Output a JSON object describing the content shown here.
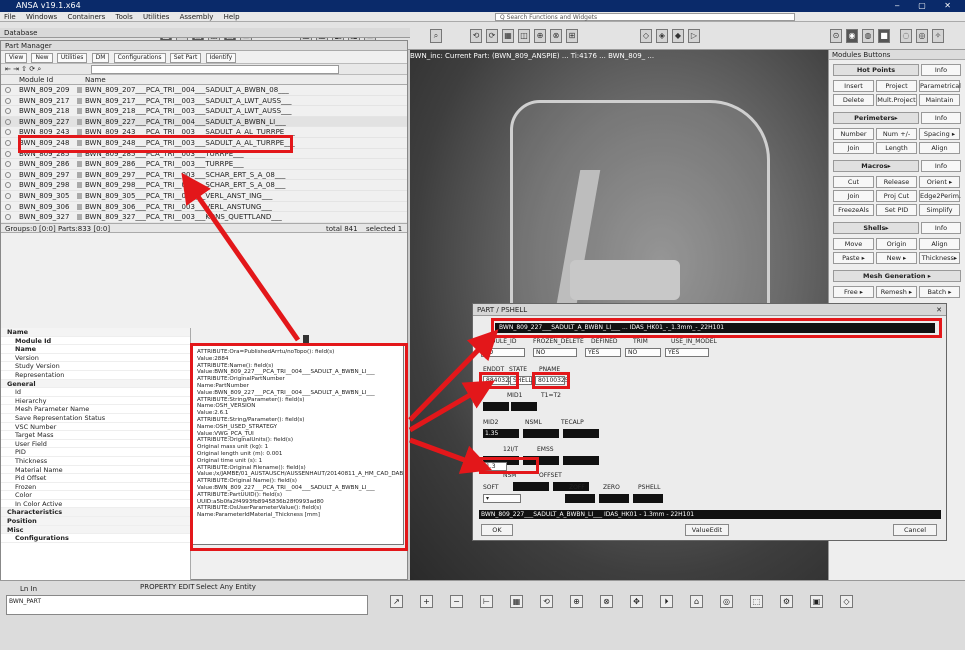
{
  "window": {
    "title": "ANSA v19.1.x64",
    "controls": "‒ ▢ ✕"
  },
  "menu": {
    "items": [
      "File",
      "Windows",
      "Containers",
      "Tools",
      "Utilities",
      "Assembly",
      "Help"
    ],
    "search_placeholder": "Q Search Functions and Widgets"
  },
  "database_label": "Database",
  "part_manager": {
    "title": "Part Manager",
    "tabs": [
      "View",
      "New",
      "Utilities",
      "DM",
      "Configurations",
      "Set Part",
      "Identify"
    ],
    "columns": [
      "Module Id",
      "Name"
    ],
    "rows": [
      {
        "id": "BWN_809_209",
        "name": "BWN_809_207___PCA_TRI__004___SADULT_A_BWBN_08___"
      },
      {
        "id": "BWN_809_217",
        "name": "BWN_809_217___PCA_TRI__003___SADULT_A_LWT_AUSS___"
      },
      {
        "id": "BWN_809_218",
        "name": "BWN_809_218___PCA_TRI__003___SADULT_A_LWT_AUSS___"
      },
      {
        "id": "BWN_809_227",
        "name": "BWN_809_227___PCA_TRI__004___SADULT_A_BWBN_LI___"
      },
      {
        "id": "BWN_809_243",
        "name": "BWN_809_243___PCA_TRI__003___SADULT_A_AL_TURRPE___"
      },
      {
        "id": "BWN_809_248",
        "name": "BWN_809_248___PCA_TRI__003___SADULT_A_AL_TURRPE___"
      },
      {
        "id": "BWN_809_285",
        "name": "BWN_809_285___PCA_TRI__003___TURRPE___"
      },
      {
        "id": "BWN_809_286",
        "name": "BWN_809_286___PCA_TRI__003___TURRPE___"
      },
      {
        "id": "BWN_809_297",
        "name": "BWN_809_297___PCA_TRI__003___SCHAR_ERT_S_A_08___"
      },
      {
        "id": "BWN_809_298",
        "name": "BWN_809_298___PCA_TRI__003___SCHAR_ERT_S_A_08___"
      },
      {
        "id": "BWN_809_305",
        "name": "BWN_809_305___PCA_TRI__003___VERL_ANST_ING___"
      },
      {
        "id": "BWN_809_306",
        "name": "BWN_809_306___PCA_TRI__003___VERL_ANSTUNG___"
      },
      {
        "id": "BWN_809_327",
        "name": "BWN_809_327___PCA_TRI__003___KONS_QUETTLAND___"
      }
    ],
    "status": {
      "left": "Groups:0  [0:0]  Parts:833  [0:0]",
      "total": "total  841",
      "selected": "selected  1"
    },
    "props_header": "Name",
    "props": [
      {
        "t": "Module Id",
        "k": "bold"
      },
      {
        "t": "Name",
        "k": "bold"
      },
      {
        "t": "Version",
        "k": ""
      },
      {
        "t": "Study Version",
        "k": ""
      },
      {
        "t": "Representation",
        "k": ""
      },
      {
        "t": "General",
        "k": "sec"
      },
      {
        "t": "Id",
        "k": ""
      },
      {
        "t": "Hierarchy",
        "k": ""
      },
      {
        "t": "Mesh Parameter Name",
        "k": ""
      },
      {
        "t": "Save Representation Status",
        "k": ""
      },
      {
        "t": "VSC Number",
        "k": ""
      },
      {
        "t": "Target Mass",
        "k": ""
      },
      {
        "t": "User Field",
        "k": ""
      },
      {
        "t": "PID",
        "k": ""
      },
      {
        "t": "Thickness",
        "k": ""
      },
      {
        "t": "Material Name",
        "k": ""
      },
      {
        "t": "Pid Offset",
        "k": ""
      },
      {
        "t": "Frozen",
        "k": ""
      },
      {
        "t": "Color",
        "k": ""
      },
      {
        "t": "In Color Active",
        "k": ""
      },
      {
        "t": "Characteristics",
        "k": "sec"
      },
      {
        "t": "Position",
        "k": "sec"
      },
      {
        "t": "Misc",
        "k": "sec"
      },
      {
        "t": "Configurations",
        "k": "bold"
      }
    ],
    "attrs": [
      "ATTRIBUTE:Ora=PublishedArrtu/noTopo(): field(s)",
      "Value:2884",
      "ATTRIBUTE:Name(): field(s)",
      "Value:BWN_809_227___PCA_TRI__004___SADULT_A_BWBN_LI___",
      "ATTRIBUTE:OriginalPartNumber",
      "Name:PartNumber",
      "Value:BWN_809_227___PCA_TRI__004___SADULT_A_BWBN_LI___",
      "ATTRIBUTE:String/Parameter(): field(s)",
      "Name:OSH_VERSION",
      "Value:2.6.1",
      "ATTRIBUTE:String/Parameter(): field(s)",
      "Name:OSH_USED_STRATEGY",
      "Value:VWG_PCA_TUI",
      "ATTRIBUTE:OriginalUnits(): field(s)",
      "Original mass unit (kg): 1",
      "Original length unit (m): 0.001",
      "Original time unit (s): 1",
      "ATTRIBUTE:Original Filename(): field(s)",
      "Value:/x/JAMBE/01_AUSTAUSCH/AUSSENHAUT/20140811_A_HM_CAD_DABM_FT.0",
      "ATTRIBUTE:Original Name(): field(s)",
      "Value:BWN_809_227___PCA_TRI__004___SADULT_A_BWBN_LI___",
      "ATTRIBUTE:PartUUID(): field(s)",
      "UUID:a5b0fa2f4993fb8945836b28f0993ad80",
      "ATTRIBUTE:OsUserParameterValue(): field(s)",
      "Name:ParameterIdMaterial_Thickness [mm]"
    ]
  },
  "viewport": {
    "info": "BWN_inc:  Current Part:  (BWN_809_ANSPIE)  ...  Ti:4176  ...  BWN_809_ ..."
  },
  "modules": {
    "title": "Modules Buttons",
    "buttons": [
      [
        "Hot Points",
        "Info"
      ],
      [
        "Insert",
        "Project",
        "Parametrical"
      ],
      [
        "Delete",
        "Mult.Project",
        "Maintain"
      ],
      [
        "Perimeters▸",
        "Info"
      ],
      [
        "Number",
        "Num +/-",
        "Spacing ▸"
      ],
      [
        "Join",
        "Length",
        "Align"
      ],
      [
        "Macros▸",
        "Info"
      ],
      [
        "Cut",
        "Release",
        "Orient ▸"
      ],
      [
        "Join",
        "Proj Cut",
        "Edge2Perim."
      ],
      [
        "FreezeAls",
        "Set PID",
        "Simplify"
      ],
      [
        "Shells▸",
        "Info"
      ],
      [
        "Move",
        "Origin",
        "Align"
      ],
      [
        "Paste ▸",
        "New ▸",
        "Thickness▸"
      ],
      [
        "Mesh Generation ▸"
      ],
      [
        "Free ▸",
        "Remesh ▸",
        "Batch ▸"
      ]
    ]
  },
  "shell_dialog": {
    "title": "PART / PSHELL",
    "header_bar": "BWN_809_227___SADULT_A_BWBN_LI___  ...  IDAS_HK01_-_1.3mm_-_22H101",
    "labels": [
      "MODULE_ID",
      "FROZEN_DELETE",
      "DEFINED",
      "TRIM",
      "USE_IN_MODEL"
    ],
    "dd_vals": [
      "NO",
      "NO",
      "YES",
      "NO",
      "YES"
    ],
    "row2_labels": [
      "ENDDT",
      "STATE",
      "PNAME"
    ],
    "pid": "8840322",
    "type": "SHELL",
    "mid": "80100325",
    "field_labels": [
      "MID1",
      "T1=T2",
      "MID2",
      "NSML",
      "TECALP",
      "12I/T",
      "EMSS",
      "DEFMAIN",
      "BRAS",
      "NSM",
      "OFFSET"
    ],
    "vals": [
      "1.35",
      "1.3"
    ],
    "misc_labels": [
      "SOFT",
      "ZOFF",
      "ZERO",
      "PSHELL"
    ],
    "footer_bar": "BWN_809_227___SADULT_A_BWBN_LI___  IDAS_HK01 - 1.3mm - 22H101",
    "btn_ok": "OK",
    "btn_mid": "ValueEdit",
    "btn_cancel": "Cancel"
  },
  "bottom": {
    "tabs": [
      "PROPERTY EDIT",
      "Select Any Entity"
    ],
    "cmd_title": "Ln   In",
    "cmd_value": "BWN_PART",
    "tools": [
      "↗",
      "+",
      "−",
      "⊢",
      "▦",
      "⟲",
      "⊕",
      "⊗",
      "✥",
      "⏵",
      "⌂",
      "◎",
      "⬚",
      "⚙",
      "▣",
      "◇"
    ]
  },
  "colors": {
    "highlight": "#e3171a",
    "title_bg": "#0a2a6a"
  }
}
